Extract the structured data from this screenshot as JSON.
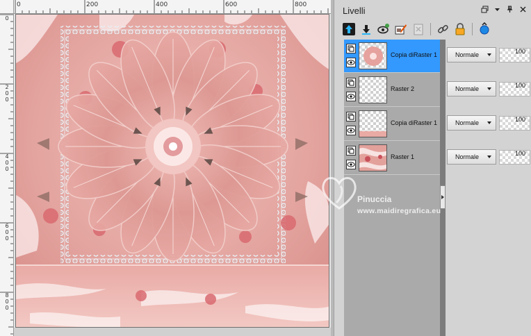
{
  "canvas": {
    "ruler_top_labels": [
      "0",
      "200",
      "400",
      "600",
      "800"
    ],
    "ruler_left_labels": [
      "0",
      "2\n0\n0",
      "4\n0\n0",
      "6\n0\n0",
      "8\n0\n0"
    ]
  },
  "layers_panel": {
    "title": "Livelli",
    "controls": [
      "restore-icon",
      "menu-arrow-icon",
      "pin-icon",
      "close-icon"
    ],
    "toolbar": [
      "new-raster-layer-icon",
      "new-vector-layer-icon",
      "layer-visibility-icon",
      "layer-properties-icon",
      "layer-delete-icon",
      "link-layer-icon",
      "lock-layer-icon",
      "lock-alpha-icon"
    ],
    "layers": [
      {
        "name": "Copia diRaster 1",
        "blend": "Normale",
        "opacity": "100",
        "selected": true,
        "thumb": "flower"
      },
      {
        "name": "Raster 2",
        "blend": "Normale",
        "opacity": "100",
        "selected": false,
        "thumb": "transparent"
      },
      {
        "name": "Copia diRaster 1",
        "blend": "Normale",
        "opacity": "100",
        "selected": false,
        "thumb": "transparent-bottom"
      },
      {
        "name": "Raster 1",
        "blend": "Normale",
        "opacity": "100",
        "selected": false,
        "thumb": "texture"
      }
    ]
  },
  "watermark": {
    "line1": "Pinuccia",
    "line2": "www.maidiregrafica.eu"
  },
  "colors": {
    "selected": "#3399ff",
    "artwork_pink": "#e8a0a0"
  }
}
